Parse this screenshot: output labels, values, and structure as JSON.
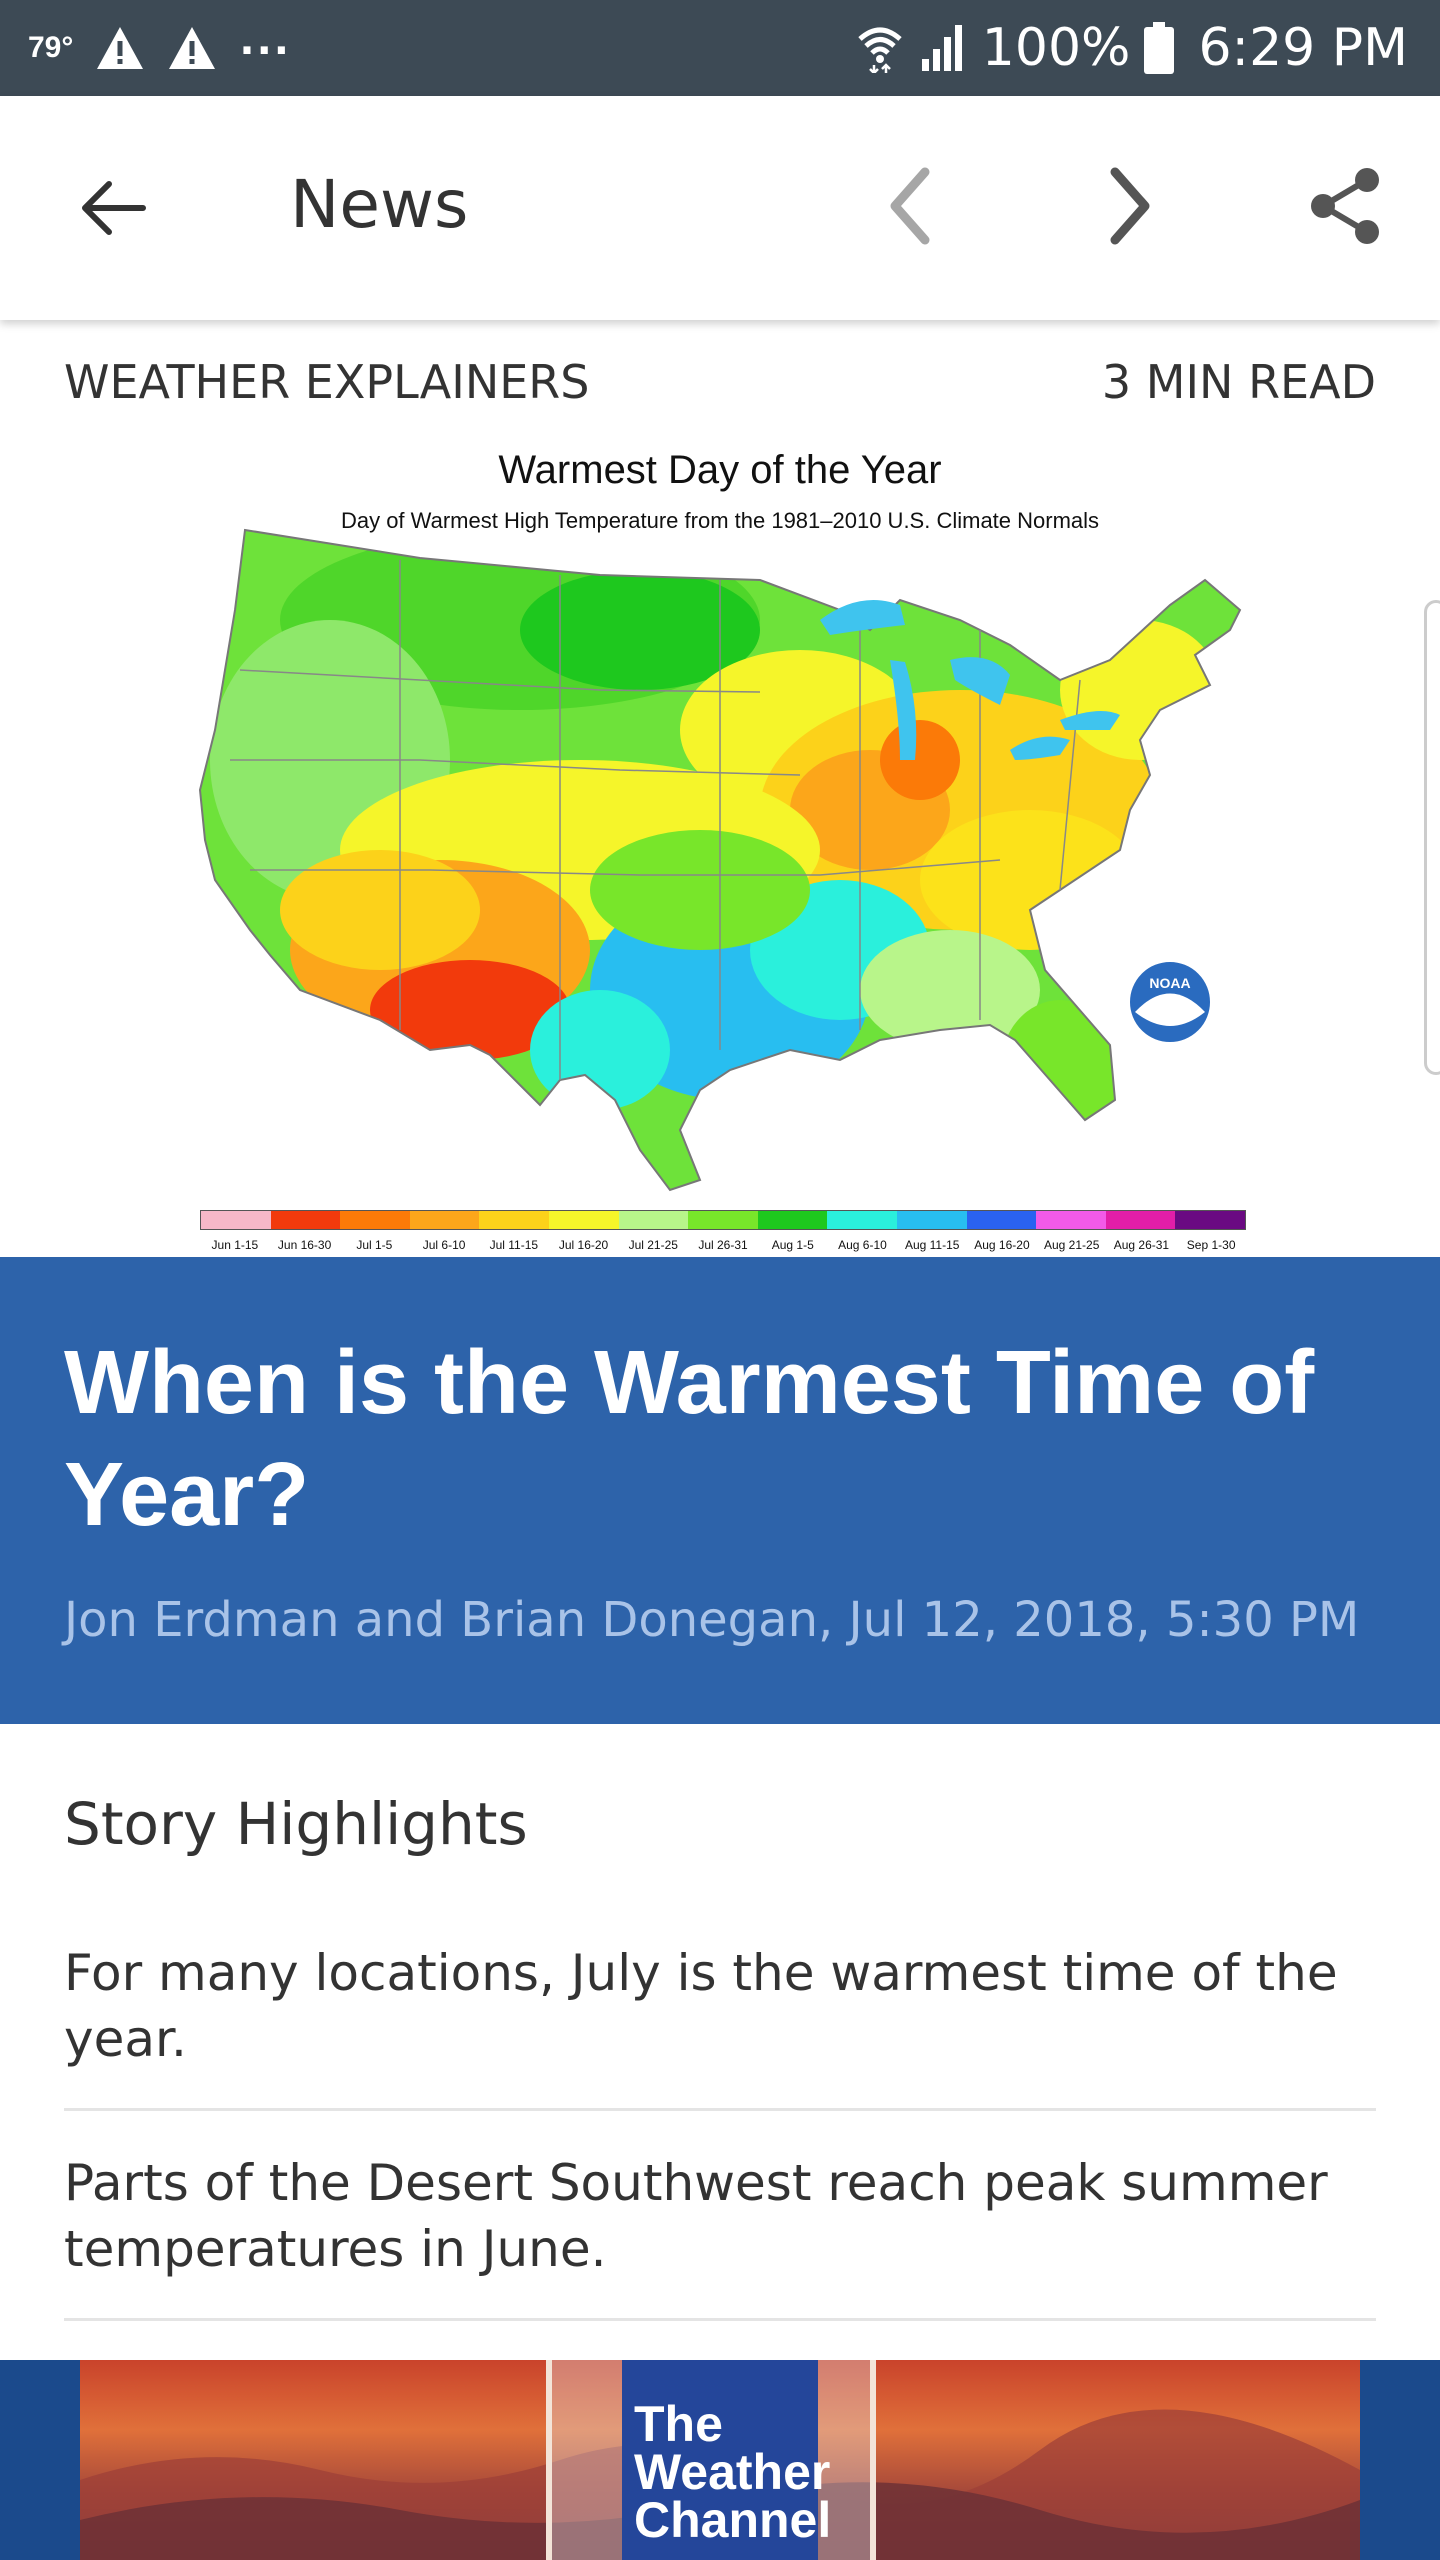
{
  "status_bar": {
    "temperature": "79°",
    "more": "...",
    "battery": "100%",
    "time": "6:29 PM"
  },
  "app_bar": {
    "title": "News"
  },
  "article": {
    "category": "WEATHER EXPLAINERS",
    "read_time": "3 MIN READ",
    "headline": "When is the Warmest Time of Year?",
    "byline": "Jon Erdman and Brian Donegan, Jul 12, 2018, 5:30 PM"
  },
  "map": {
    "title": "Warmest Day of the Year",
    "subtitle": "Day of Warmest High Temperature from the 1981–2010 U.S. Climate Normals",
    "logo_text": "NOAA",
    "legend": [
      {
        "label": "Jun 1-15",
        "color": "#f7b8c8"
      },
      {
        "label": "Jun 16-30",
        "color": "#f23a0c"
      },
      {
        "label": "Jul 1-5",
        "color": "#fb7a08"
      },
      {
        "label": "Jul 6-10",
        "color": "#fca61a"
      },
      {
        "label": "Jul 11-15",
        "color": "#fcd21a"
      },
      {
        "label": "Jul 16-20",
        "color": "#f5f52a"
      },
      {
        "label": "Jul 21-25",
        "color": "#b8f58a"
      },
      {
        "label": "Jul 26-31",
        "color": "#78e62a"
      },
      {
        "label": "Aug 1-5",
        "color": "#1ec81e"
      },
      {
        "label": "Aug 6-10",
        "color": "#2af0dc"
      },
      {
        "label": "Aug 11-15",
        "color": "#28bef0"
      },
      {
        "label": "Aug 16-20",
        "color": "#2a62f0"
      },
      {
        "label": "Aug 21-25",
        "color": "#f25ae8"
      },
      {
        "label": "Aug 26-31",
        "color": "#e21ea8"
      },
      {
        "label": "Sep 1-30",
        "color": "#6a0a82"
      }
    ]
  },
  "highlights": {
    "heading": "Story Highlights",
    "items": [
      "For many locations, July is the warmest time of the year.",
      "Parts of the Desert Southwest reach peak summer temperatures in June."
    ]
  },
  "ad": {
    "logo_text": "The Weather Channel"
  },
  "colors": {
    "status_bar": "#3d4a55",
    "headline_bg": "#2d63aa",
    "byline": "#a9c3e8"
  }
}
